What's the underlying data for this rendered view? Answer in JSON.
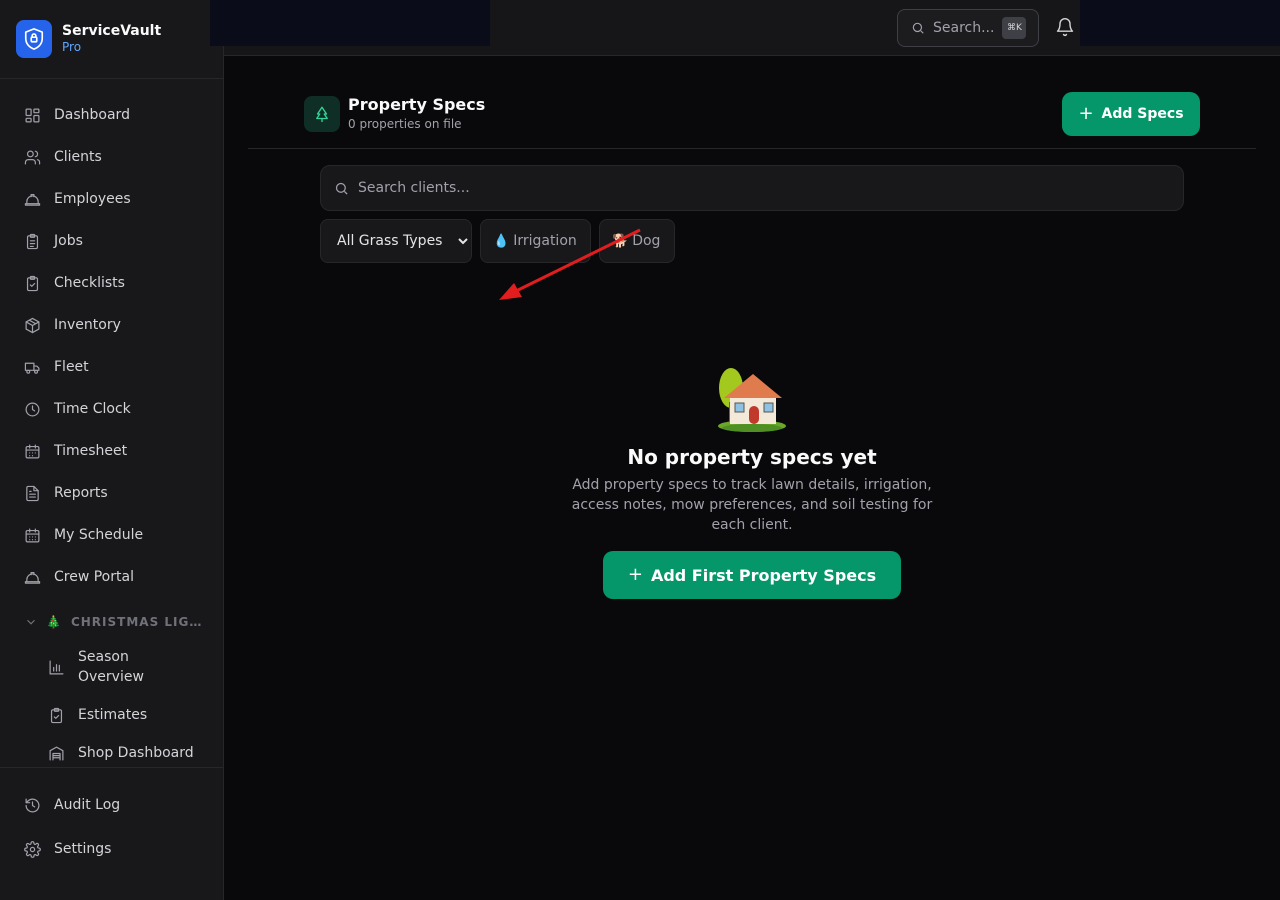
{
  "brand": {
    "name": "ServiceVault",
    "plan": "Pro",
    "logo_icon": "shield-lock-icon"
  },
  "sidebar": {
    "items": [
      {
        "label": "Dashboard",
        "icon": "dashboard-icon"
      },
      {
        "label": "Clients",
        "icon": "users-icon"
      },
      {
        "label": "Employees",
        "icon": "hard-hat-icon"
      },
      {
        "label": "Jobs",
        "icon": "clipboard-list-icon"
      },
      {
        "label": "Checklists",
        "icon": "clipboard-check-icon"
      },
      {
        "label": "Inventory",
        "icon": "package-icon"
      },
      {
        "label": "Fleet",
        "icon": "truck-icon"
      },
      {
        "label": "Time Clock",
        "icon": "clock-icon"
      },
      {
        "label": "Timesheet",
        "icon": "calendar-icon"
      },
      {
        "label": "Reports",
        "icon": "file-text-icon"
      },
      {
        "label": "My Schedule",
        "icon": "calendar-days-icon"
      },
      {
        "label": "Crew Portal",
        "icon": "hard-hat-icon"
      }
    ],
    "section": {
      "emoji": "🎄",
      "title": "CHRISTMAS LIG…",
      "items": [
        {
          "label": "Season Overview",
          "icon": "bar-chart-icon"
        },
        {
          "label": "Estimates",
          "icon": "clipboard-check-icon"
        },
        {
          "label": "Shop Dashboard",
          "icon": "warehouse-icon"
        }
      ]
    },
    "bottom": [
      {
        "label": "Audit Log",
        "icon": "history-icon"
      },
      {
        "label": "Settings",
        "icon": "gear-icon"
      }
    ]
  },
  "topbar": {
    "search_placeholder": "Search...",
    "shortcut": "⌘K"
  },
  "header": {
    "title": "Property Specs",
    "subtitle": "0 properties on file",
    "add_button": "Add Specs"
  },
  "filters": {
    "search_placeholder": "Search clients...",
    "grass_select": "All Grass Types",
    "irrigation_chip": {
      "emoji": "💧",
      "label": "Irrigation"
    },
    "dog_chip": {
      "emoji": "🐕",
      "label": "Dog"
    }
  },
  "empty_state": {
    "emoji": "🏡",
    "title": "No property specs yet",
    "description": "Add property specs to track lawn details, irrigation, access notes, mow preferences, and soil testing for each client.",
    "button": "Add First Property Specs"
  },
  "colors": {
    "accent": "#059669",
    "brand": "#2563eb",
    "annotation": "#e11d1d"
  }
}
